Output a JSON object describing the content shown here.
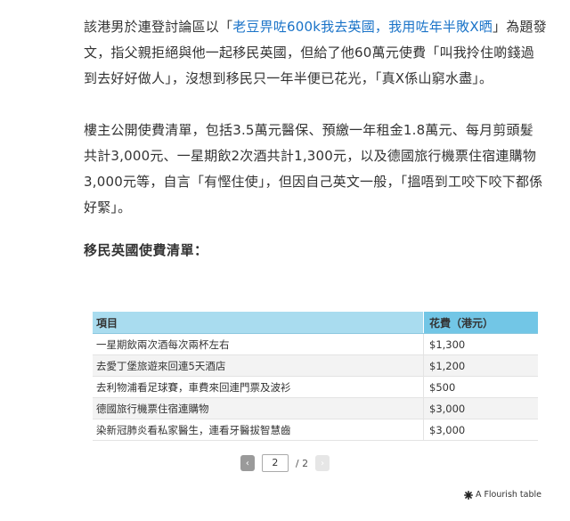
{
  "article": {
    "p1": {
      "prefix": "該港男於連登討論區以「",
      "link": "老豆畀咗600k我去英國，我用咗年半敗X晒",
      "suffix": "」為題發文，指父親拒絕與他一起移民英國，但給了他60萬元使費「叫我拎住啲錢過到去好好做人」，沒想到移民只一年半便已花光，「真X係山窮水盡」。"
    },
    "p2": "樓主公開使費清單，包括3.5萬元醫保、預繳一年租金1.8萬元、每月剪頭髮共計3,000元、一星期飲2次酒共計1,300元，以及德國旅行機票住宿連購物3,000元等，自言「有慳住使」，但因自己英文一般，「搵唔到工咬下咬下都係好緊」。",
    "section_title": "移民英國使費清單："
  },
  "table": {
    "headers": {
      "item": "項目",
      "cost": "花費（港元）"
    },
    "rows": [
      {
        "item": "一星期飲兩次酒每次兩杯左右",
        "cost": "$1,300"
      },
      {
        "item": "去愛丁堡旅遊來回連5天酒店",
        "cost": "$1,200"
      },
      {
        "item": "去利物浦看足球賽，車費來回連門票及波衫",
        "cost": "$500"
      },
      {
        "item": "德國旅行機票住宿連購物",
        "cost": "$3,000"
      },
      {
        "item": "染新冠肺炎看私家醫生，連看牙醫拔智慧齒",
        "cost": "$3,000"
      }
    ]
  },
  "pagination": {
    "prev_icon": "‹",
    "current_page": "2",
    "total": "/ 2",
    "next_icon": "›"
  },
  "footer": {
    "credit": "A Flourish table"
  }
}
